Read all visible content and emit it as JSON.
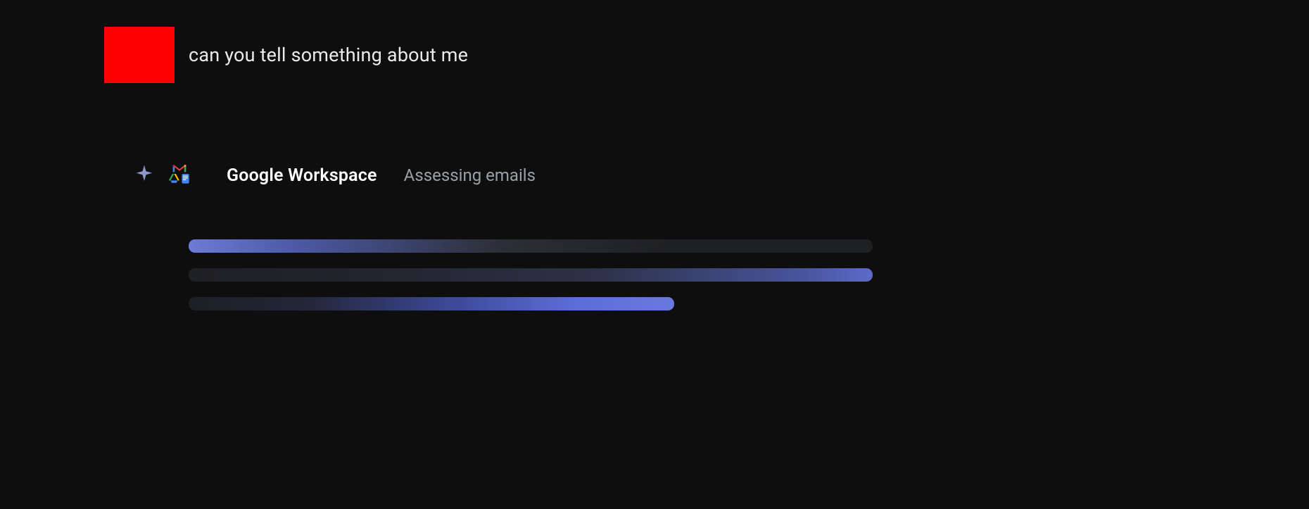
{
  "user": {
    "message": "can you tell something about me",
    "avatar_color": "#ff0000"
  },
  "assistant": {
    "status_title": "Google Workspace",
    "status_subtitle": "Assessing emails"
  }
}
